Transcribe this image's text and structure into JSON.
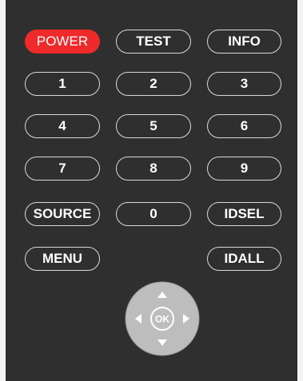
{
  "remote": {
    "buttons": {
      "power": "POWER",
      "test": "TEST",
      "info": "INFO",
      "n1": "1",
      "n2": "2",
      "n3": "3",
      "n4": "4",
      "n5": "5",
      "n6": "6",
      "n7": "7",
      "n8": "8",
      "n9": "9",
      "source": "SOURCE",
      "n0": "0",
      "idsel": "IDSEL",
      "menu": "MENU",
      "idall": "IDALL"
    },
    "dpad": {
      "ok": "OK"
    },
    "colors": {
      "panel": "#2f2f2f",
      "power_bg": "#ee2a2a",
      "button_border": "#d9d9d9",
      "dpad_fill": "#bdbdbd"
    },
    "icons": [
      "arrow-up-icon",
      "arrow-down-icon",
      "arrow-left-icon",
      "arrow-right-icon"
    ]
  }
}
